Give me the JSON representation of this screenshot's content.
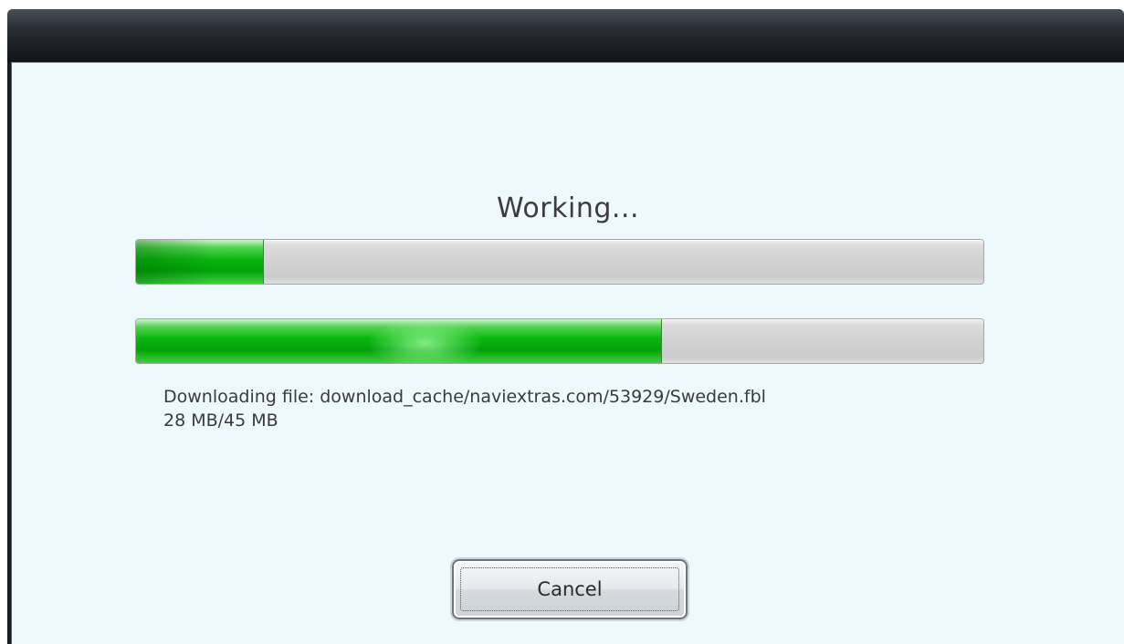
{
  "dialog": {
    "heading": "Working...",
    "overall_progress": {
      "fraction": 0.15
    },
    "file_progress": {
      "fraction": 0.62
    },
    "status_line": "Downloading file: download_cache/naviextras.com/53929/Sweden.fbl",
    "size_line": "28 MB/45 MB",
    "cancel_label": "Cancel"
  },
  "colors": {
    "progress_fill": "#08b60e",
    "progress_track": "#d2d2d2",
    "client_background": "#eef9fd",
    "titlebar": "#1a1d22"
  }
}
